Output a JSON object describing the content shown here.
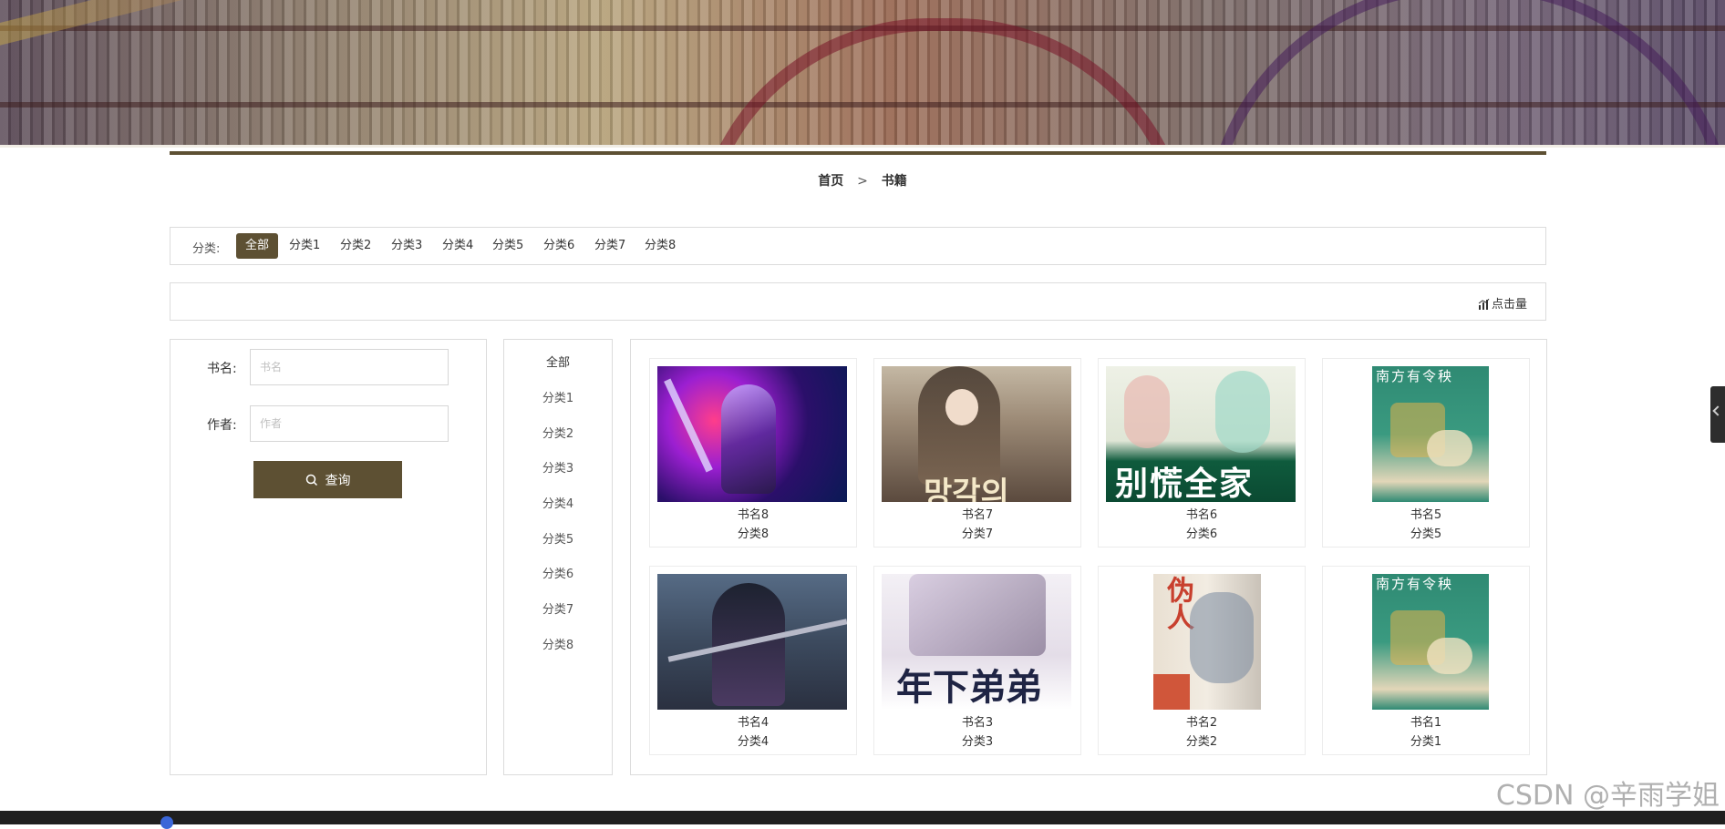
{
  "breadcrumb": {
    "home": "首页",
    "separator": ">",
    "current": "书籍"
  },
  "filter": {
    "label": "分类:",
    "options": [
      "全部",
      "分类1",
      "分类2",
      "分类3",
      "分类4",
      "分类5",
      "分类6",
      "分类7",
      "分类8"
    ],
    "selected": "全部"
  },
  "sort": {
    "label": "点击量",
    "icon": "bar-chart-icon"
  },
  "search": {
    "name_label": "书名:",
    "name_placeholder": "书名",
    "author_label": "作者:",
    "author_placeholder": "作者",
    "button_label": "查询",
    "button_icon": "search-icon"
  },
  "category_list": [
    "全部",
    "分类1",
    "分类2",
    "分类3",
    "分类4",
    "分类5",
    "分类6",
    "分类7",
    "分类8"
  ],
  "books": [
    {
      "title": "书名8",
      "category": "分类8",
      "cover_text": ""
    },
    {
      "title": "书名7",
      "category": "分类7",
      "cover_text": "망각의"
    },
    {
      "title": "书名6",
      "category": "分类6",
      "cover_text": "别慌全家"
    },
    {
      "title": "书名5",
      "category": "分类5",
      "cover_text": "南方有令秧"
    },
    {
      "title": "书名4",
      "category": "分类4",
      "cover_text": ""
    },
    {
      "title": "书名3",
      "category": "分类3",
      "cover_text": "年下弟弟"
    },
    {
      "title": "书名2",
      "category": "分类2",
      "cover_text": "伪人"
    },
    {
      "title": "书名1",
      "category": "分类1",
      "cover_text": "南方有令秧"
    }
  ],
  "watermark": "CSDN @辛雨学姐",
  "colors": {
    "accent": "#5d5033",
    "border": "#dcdcdc"
  }
}
